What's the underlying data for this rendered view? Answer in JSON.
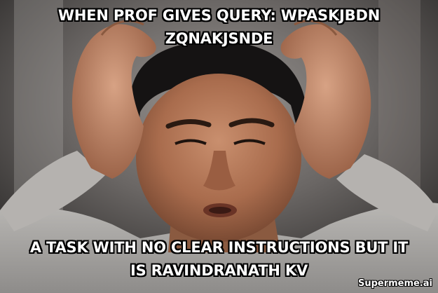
{
  "meme": {
    "top_text_line1": "WHEN PROF GIVES QUERY: WPASKJBDN",
    "top_text_line2": "ZQNAKJSNDE",
    "bottom_text_line1": "A TASK WITH NO CLEAR INSTRUCTIONS BUT IT",
    "bottom_text_line2": "IS RAVINDRANATH KV",
    "watermark": "Supermeme.ai"
  },
  "colors": {
    "caption_fill": "#ffffff",
    "caption_outline": "#000000",
    "background": "#5e5a58"
  }
}
